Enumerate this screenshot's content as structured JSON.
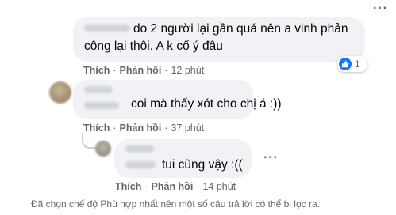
{
  "comments": [
    {
      "text_line1": "do 2 người lại gần quá nên a vinh phản",
      "text_line2": "công lại thôi. A k cố ý đâu",
      "like_label": "Thích",
      "reply_label": "Phản hồi",
      "time": "12 phút",
      "reaction": {
        "icon": "like-icon",
        "count": "1"
      }
    },
    {
      "text": "coi mà thấy xót cho chị á :))",
      "like_label": "Thích",
      "reply_label": "Phản hồi",
      "time": "37 phút"
    },
    {
      "text": "tui cũng vậy :((",
      "like_label": "Thích",
      "reply_label": "Phản hồi",
      "time": "14 phút"
    }
  ],
  "filter_notice": "Đã chọn chế độ Phù hợp nhất nên một số câu trả lời có thể bị lọc ra.",
  "colors": {
    "bubble": "#f0f2f5",
    "secondary_text": "#65676b",
    "like_blue": "#1877f2"
  }
}
